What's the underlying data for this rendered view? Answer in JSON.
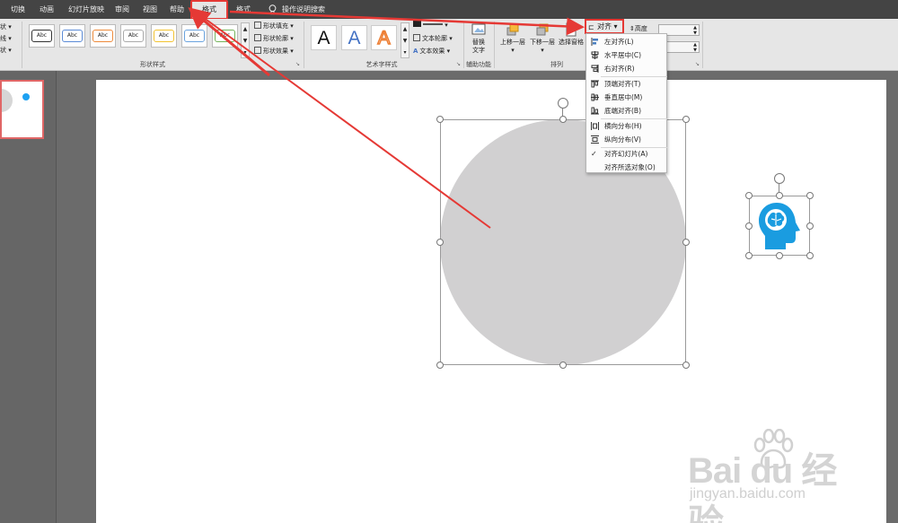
{
  "tabs": [
    "切换",
    "动画",
    "幻灯片放映",
    "审阅",
    "视图",
    "帮助",
    "格式",
    "格式"
  ],
  "search": {
    "label": "操作说明搜索",
    "icon": "lightbulb-icon"
  },
  "left_fragments": [
    "状",
    "线",
    "状"
  ],
  "ribbon": {
    "shape_style_samples": [
      "Abc",
      "Abc",
      "Abc",
      "Abc",
      "Abc",
      "Abc",
      "Abc"
    ],
    "shape_commands": [
      "形状填充",
      "形状轮廓",
      "形状效果"
    ],
    "shape_styles_label": "形状样式",
    "wordart_letters": [
      "A",
      "A",
      "A"
    ],
    "text_commands": [
      "文本轮廓",
      "文本效果"
    ],
    "wordart_label": "艺术字样式",
    "alt_text": "替换文字",
    "accessibility_label": "辅助功能",
    "arrange": {
      "bring_forward": "上移一层",
      "send_backward": "下移一层",
      "selection_pane": "选择窗格",
      "label": "排列"
    },
    "align_button": "对齐",
    "height_label": "高度"
  },
  "dropdown": {
    "items": [
      {
        "label": "左对齐(L)",
        "checked": false,
        "icon": "align-left-icon"
      },
      {
        "label": "水平居中(C)",
        "checked": false,
        "icon": "align-center-icon"
      },
      {
        "label": "右对齐(R)",
        "checked": false,
        "icon": "align-right-icon"
      },
      {
        "label": "顶端对齐(T)",
        "checked": false,
        "icon": "align-top-icon"
      },
      {
        "label": "垂直居中(M)",
        "checked": false,
        "icon": "align-middle-icon"
      },
      {
        "label": "底端对齐(B)",
        "checked": false,
        "icon": "align-bottom-icon"
      },
      {
        "label": "横向分布(H)",
        "checked": false,
        "icon": "distribute-horizontal-icon"
      },
      {
        "label": "纵向分布(V)",
        "checked": false,
        "icon": "distribute-vertical-icon"
      },
      {
        "label": "对齐幻灯片(A)",
        "checked": true,
        "icon": "check-icon"
      },
      {
        "label": "对齐所选对象(O)",
        "checked": false,
        "icon": ""
      }
    ]
  },
  "slide": {
    "circle_color": "#d1d0d1",
    "head_icon_color": "#1a9ce0"
  },
  "watermark": {
    "logo": "Bai du 经验",
    "url": "jingyan.baidu.com"
  },
  "colors": {
    "annotation_red": "#e53935",
    "tab_bar": "#444444",
    "ribbon": "#e6e6e6"
  }
}
